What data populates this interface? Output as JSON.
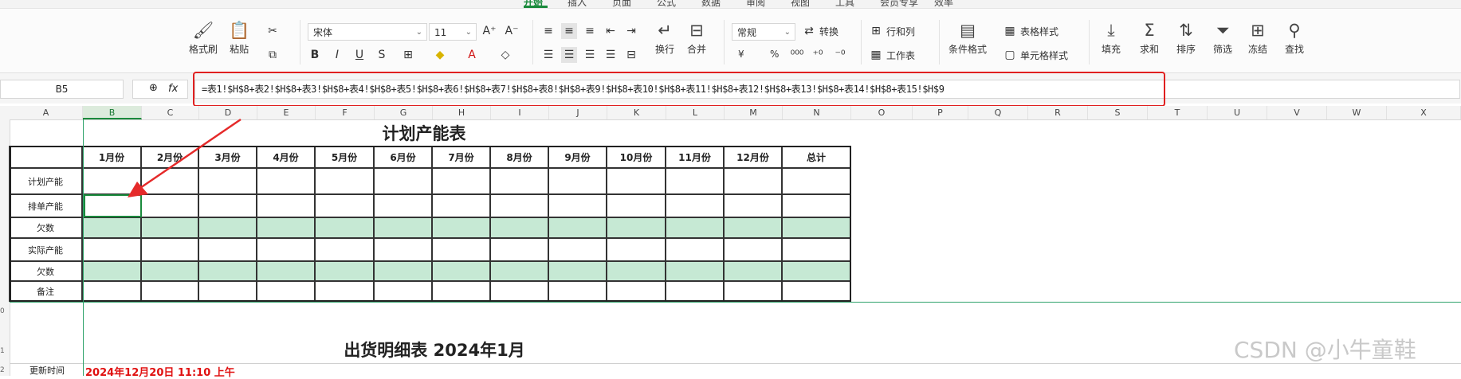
{
  "top_tabs": [
    "开始",
    "插入",
    "页面",
    "公式",
    "数据",
    "审阅",
    "视图",
    "工具",
    "会员专享",
    "效率"
  ],
  "ribbon": {
    "format_painter": "格式刷",
    "paste": "粘贴",
    "font_name": "宋体",
    "font_size": "11",
    "wrap": "换行",
    "merge": "合并",
    "number_format": "常规",
    "convert": "转换",
    "rows_cols": "行和列",
    "worksheet": "工作表",
    "cond_format": "条件格式",
    "table_style": "表格样式",
    "cell_style": "单元格样式",
    "fill": "填充",
    "sum": "求和",
    "sort": "排序",
    "filter": "筛选",
    "freeze": "冻结",
    "find": "查找",
    "percent": "%",
    "currency": "¥"
  },
  "formula_bar": {
    "cell_ref": "B5",
    "fx": "fx",
    "formula": "=表1!$H$8+表2!$H$8+表3!$H$8+表4!$H$8+表5!$H$8+表6!$H$8+表7!$H$8+表8!$H$8+表9!$H$8+表10!$H$8+表11!$H$8+表12!$H$8+表13!$H$8+表14!$H$8+表15!$H$9"
  },
  "columns": [
    "A",
    "B",
    "C",
    "D",
    "E",
    "F",
    "G",
    "H",
    "I",
    "J",
    "K",
    "L",
    "M",
    "N",
    "O",
    "P",
    "Q",
    "R",
    "S",
    "T",
    "U",
    "V",
    "W",
    "X"
  ],
  "row_numbers": [
    "0",
    "1",
    "2"
  ],
  "sheet": {
    "title": "计划产能表",
    "header_months": [
      "1月份",
      "2月份",
      "3月份",
      "4月份",
      "5月份",
      "6月份",
      "7月份",
      "8月份",
      "9月份",
      "10月份",
      "11月份",
      "12月份",
      "总计"
    ],
    "row_labels": [
      "计划产能",
      "排单产能",
      "欠数",
      "实际产能",
      "欠数",
      "备注"
    ],
    "title2": "出货明细表  2024年1月",
    "update_label": "更新时间",
    "update_value": "2024年12月20日 11:10 上午"
  },
  "colors": {
    "accent": "#1a8a3c",
    "highlight": "#e02020",
    "green_fill": "#c6e9d4"
  },
  "watermark": "CSDN @小牛童鞋"
}
